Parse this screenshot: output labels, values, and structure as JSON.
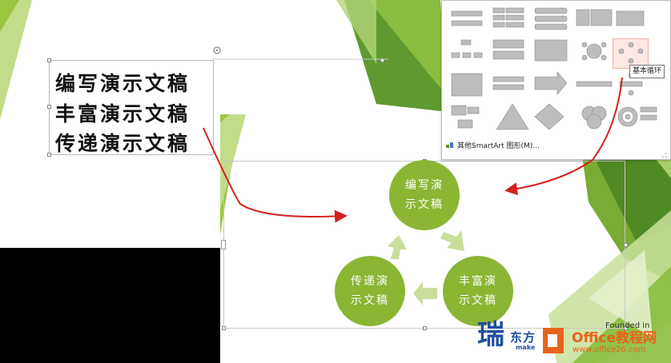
{
  "text_lines": [
    "编写演示文稿",
    "丰富演示文稿",
    "传递演示文稿"
  ],
  "cycle_nodes": [
    "编写演示文稿",
    "丰富演示文稿",
    "传递演示文稿"
  ],
  "gallery": {
    "tooltip": "基本循环",
    "more_label": "其他SmartArt 图形(M)..."
  },
  "watermarks": {
    "brand": "东方",
    "brand_sub": "make",
    "office": "Office教程网",
    "site": "www.office26.com",
    "founded": "Founded in"
  },
  "colors": {
    "green": "#8cb534",
    "light_green": "#c8de9a",
    "dark_green": "#5a8a2a",
    "arrow_red": "#d42020",
    "highlight": "#fbe7e3"
  }
}
